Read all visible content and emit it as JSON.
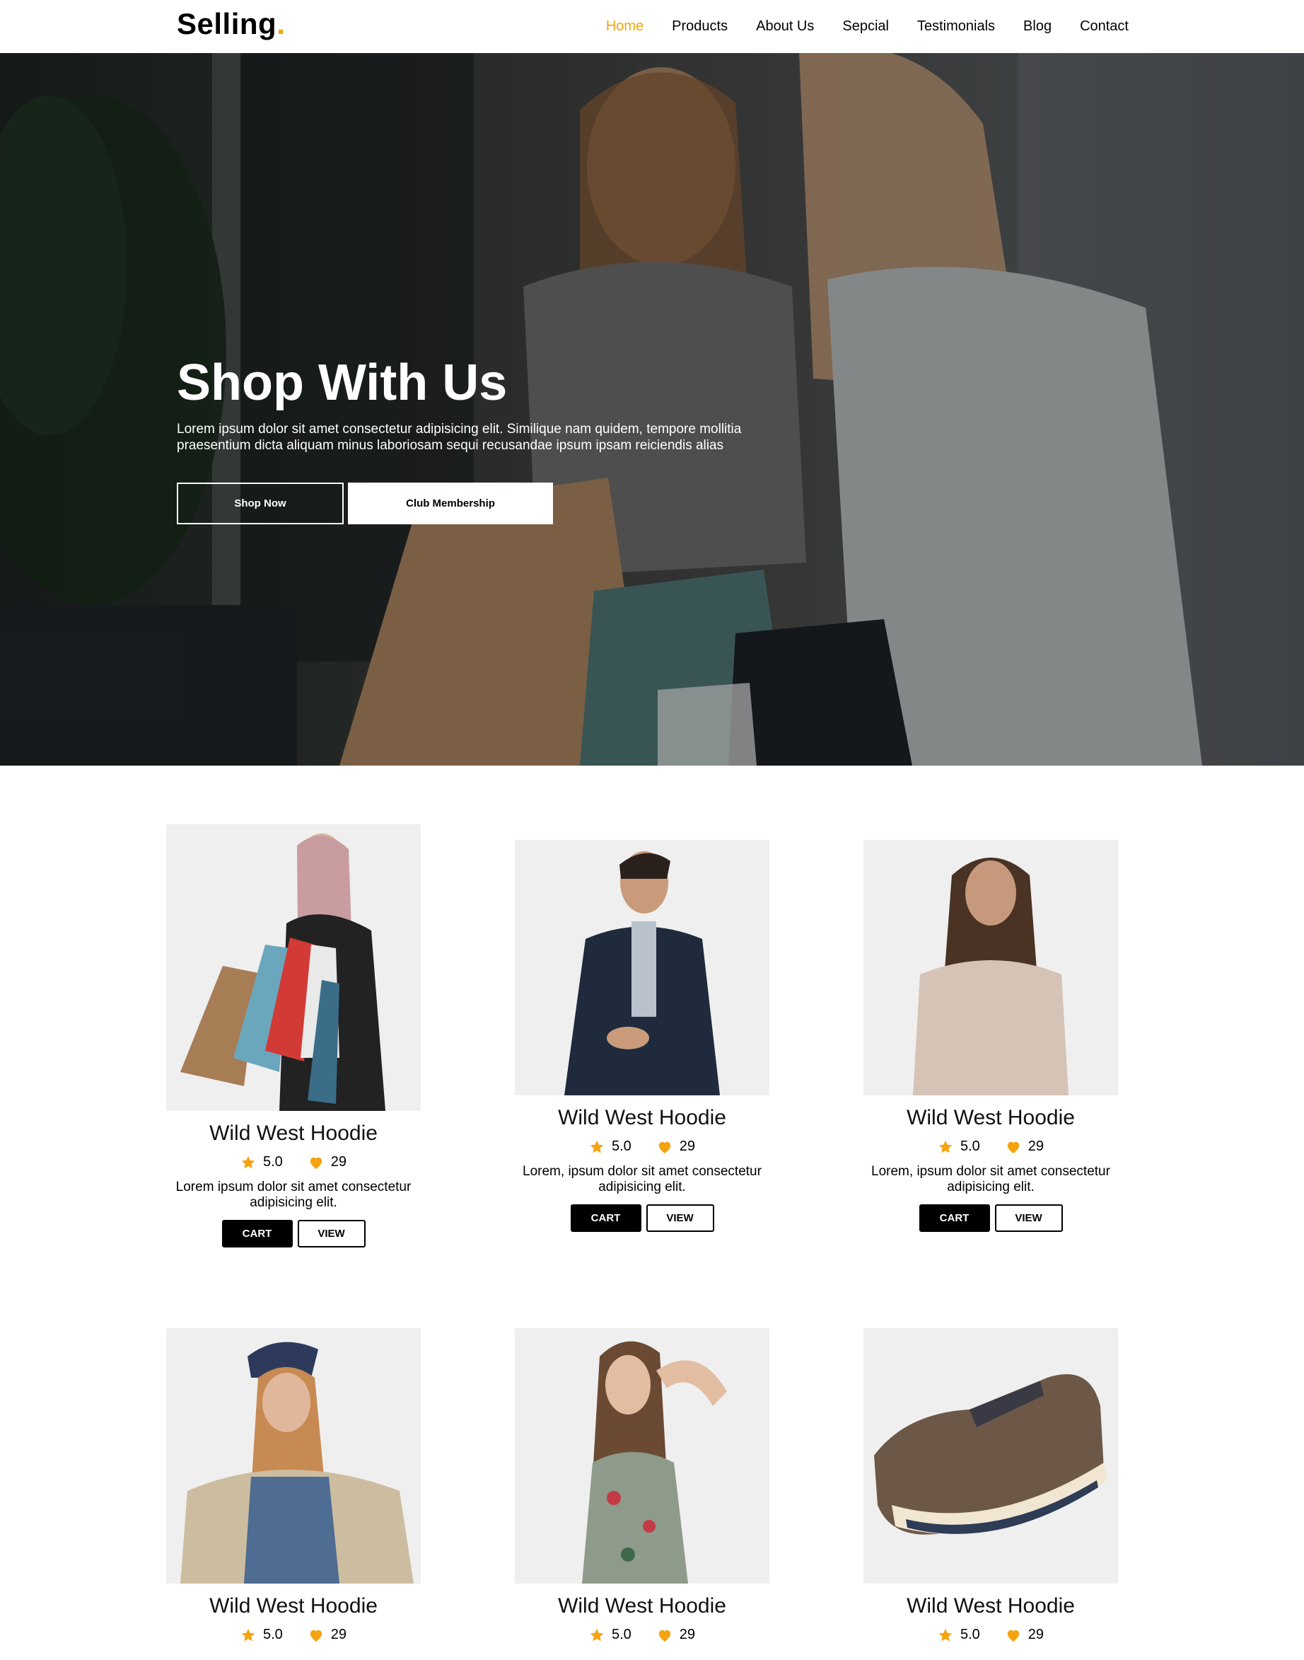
{
  "brand": {
    "name": "Selling",
    "dot": ".",
    "accent": "#f5a30f"
  },
  "nav": {
    "items": [
      {
        "label": "Home",
        "active": true
      },
      {
        "label": "Products",
        "active": false
      },
      {
        "label": "About Us",
        "active": false
      },
      {
        "label": "Sepcial",
        "active": false
      },
      {
        "label": "Testimonials",
        "active": false
      },
      {
        "label": "Blog",
        "active": false
      },
      {
        "label": "Contact",
        "active": false
      }
    ]
  },
  "hero": {
    "title": "Shop With Us",
    "text": "Lorem ipsum dolor sit amet consectetur adipisicing elit. Similique nam quidem, tempore mollitia praesentium dicta aliquam minus laboriosam sequi recusandae ipsum ipsam reiciendis alias",
    "primary_button": "Shop Now",
    "secondary_button": "Club Membership"
  },
  "products": [
    {
      "title": "Wild West Hoodie",
      "rating": "5.0",
      "likes": "29",
      "desc": "Lorem ipsum dolor sit amet consectetur adipisicing elit.",
      "cart": "CART",
      "view": "VIEW",
      "image": "woman-with-shopping-bags"
    },
    {
      "title": "Wild West Hoodie",
      "rating": "5.0",
      "likes": "29",
      "desc": "Lorem, ipsum dolor sit amet consectetur adipisicing elit.",
      "cart": "CART",
      "view": "VIEW",
      "image": "man-in-suit"
    },
    {
      "title": "Wild West Hoodie",
      "rating": "5.0",
      "likes": "29",
      "desc": "Lorem, ipsum dolor sit amet consectetur adipisicing elit.",
      "cart": "CART",
      "view": "VIEW",
      "image": "woman-in-sweater"
    },
    {
      "title": "Wild West Hoodie",
      "rating": "5.0",
      "likes": "29",
      "desc": "",
      "cart": "",
      "view": "",
      "image": "woman-in-hat"
    },
    {
      "title": "Wild West Hoodie",
      "rating": "5.0",
      "likes": "29",
      "desc": "",
      "cart": "",
      "view": "",
      "image": "woman-in-floral-dress"
    },
    {
      "title": "Wild West Hoodie",
      "rating": "5.0",
      "likes": "29",
      "desc": "",
      "cart": "",
      "view": "",
      "image": "brown-sneaker"
    }
  ],
  "icons": {
    "rating": "star-icon",
    "likes": "heart-icon"
  }
}
